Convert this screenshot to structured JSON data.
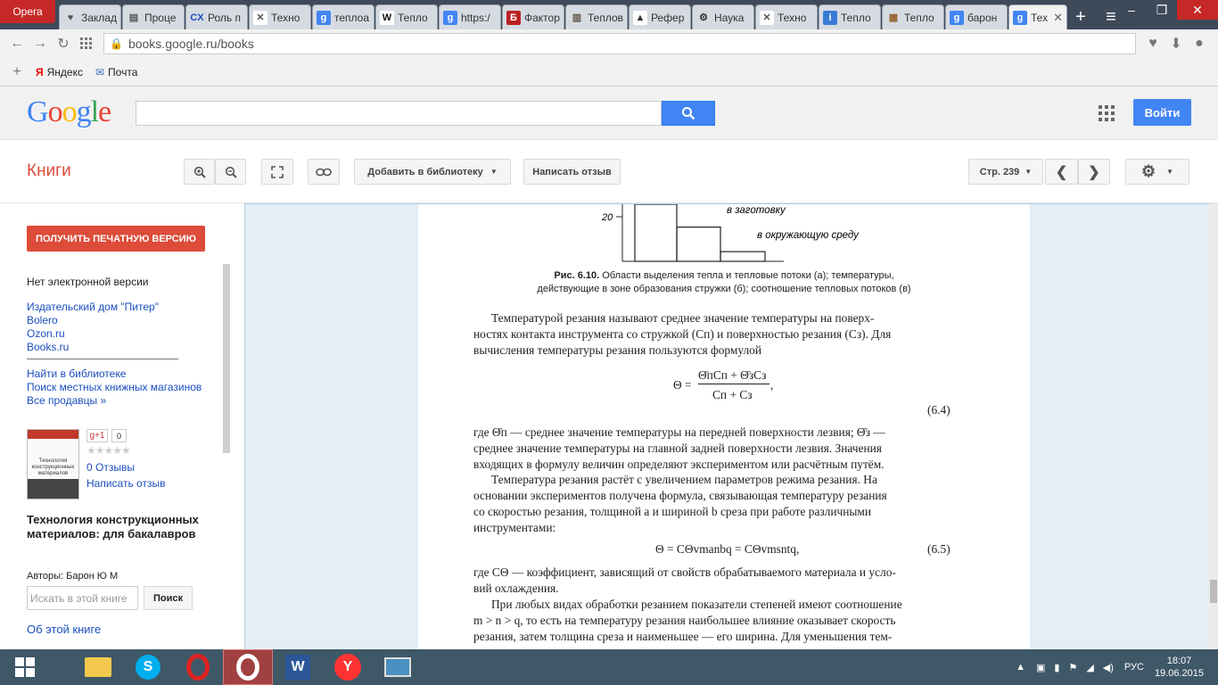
{
  "browser": {
    "menu_label": "Opera",
    "tabs": [
      {
        "label": "Заклад",
        "icon": "heart-icon"
      },
      {
        "label": "Проце",
        "icon": "page-icon"
      },
      {
        "label": "Роль п",
        "icon": "cx-icon"
      },
      {
        "label": "Техно",
        "icon": "doc-icon"
      },
      {
        "label": "теплоа",
        "icon": "google-g-icon"
      },
      {
        "label": "Тепло",
        "icon": "wikipedia-icon"
      },
      {
        "label": "https:/",
        "icon": "google-g-icon"
      },
      {
        "label": "Фактор",
        "icon": "b-icon"
      },
      {
        "label": "Теплов",
        "icon": "book-icon"
      },
      {
        "label": "Рефер",
        "icon": "cap-icon"
      },
      {
        "label": "Наука",
        "icon": "gear-icon"
      },
      {
        "label": "Техно",
        "icon": "doc-icon"
      },
      {
        "label": "Тепло",
        "icon": "info-icon"
      },
      {
        "label": "Тепло",
        "icon": "picture-icon"
      },
      {
        "label": "барон",
        "icon": "google-g-icon"
      },
      {
        "label": "Тех",
        "icon": "google-g-icon",
        "active": true
      }
    ],
    "address": "books.google.ru/books",
    "bookmarks": [
      {
        "label": "Яндекс"
      },
      {
        "label": "Почта"
      }
    ]
  },
  "google": {
    "logo": "Google",
    "signin_label": "Войти"
  },
  "toolbar": {
    "section_title": "Книги",
    "add_library_label": "Добавить в библиотеку",
    "write_review_label": "Написать отзыв",
    "page_label": "Стр. 239"
  },
  "sidebar": {
    "print_button": "ПОЛУЧИТЬ ПЕЧАТНУЮ ВЕРСИЮ",
    "no_ebook": "Нет электронной версии",
    "sellers": [
      "Издательский дом \"Питер\"",
      "Bolero",
      "Ozon.ru",
      "Books.ru"
    ],
    "find_library": "Найти в библиотеке",
    "local_stores": "Поиск местных книжных магазинов",
    "all_sellers": "Все продавцы »",
    "gplus": "g+1",
    "gplus_count": "0",
    "reviews": "0 Отзывы",
    "write_review": "Написать отзыв",
    "book_title": "Технология конструкционных материалов: для бакалавров",
    "authors": "Авторы: Барон Ю М",
    "search_placeholder": "Искать в этой книге",
    "search_button": "Поиск",
    "about": "Об этой книге",
    "cover_title": "Технология конструкционных материалов"
  },
  "page": {
    "chart": {
      "tick_label": "20",
      "label_workpiece": "в заготовку",
      "label_environment": "в окружающую среду",
      "bars": [
        {
          "value": 1.0
        },
        {
          "value": 0.6
        },
        {
          "value": 0.17
        }
      ]
    },
    "caption_bold": "Рис. 6.10.",
    "caption_line1": " Области выделения тепла и тепловые потоки (а); температуры,",
    "caption_line2": "действующие в зоне образования стружки (б); соотношение тепловых потоков (в)",
    "para1_l1": "Температурой резания    называют среднее значение температуры на поверх-",
    "para1_l2": "ностях контакта инструмента со стружкой (Cп) и поверхностью резания (Cз). Для",
    "para1_l3": "вычисления температуры резания пользуются формулой",
    "formula1_lhs": "Θ =",
    "formula1_num": "Θ̄пCп + Θ̄зCз",
    "formula1_den": "Cп + Cз",
    "formula1_comma": ",",
    "formula1_no": "(6.4)",
    "para2_l1": "где Θ̄п — среднее значение температуры на передней поверхности лезвия; Θ̄з —",
    "para2_l2": "среднее значение температуры на главной задней поверхности лезвия. Значения",
    "para2_l3": "входящих в формулу величин определяют экспериментом или расчётным путём.",
    "para3_l1": "Температура резания растёт с увеличением параметров режима резания. На",
    "para3_l2": "основании экспериментов получена формула, связывающая температуру резания",
    "para3_l3": "со скоростью резания, толщиной a и шириной b среза при работе различными",
    "para3_l4": "инструментами:",
    "formula2": "Θ = CΘvmanbq = CΘvmsntq,",
    "formula2_no": "(6.5)",
    "para4_l1": "где CΘ — коэффициент, зависящий от свойств обрабатываемого материала и усло-",
    "para4_l2": "вий охлаждения.",
    "para5_l1": "При любых видах обработки резанием показатели степеней имеют соотношение",
    "para5_l2": "m > n > q, то есть на температуру резания наибольшее влияние оказывает скорость",
    "para5_l3": "резания, затем толщина среза и наименьшее — его ширина. Для уменьшения тем-"
  },
  "taskbar": {
    "lang": "РУС",
    "time": "18:07",
    "date": "19.06.2015"
  }
}
